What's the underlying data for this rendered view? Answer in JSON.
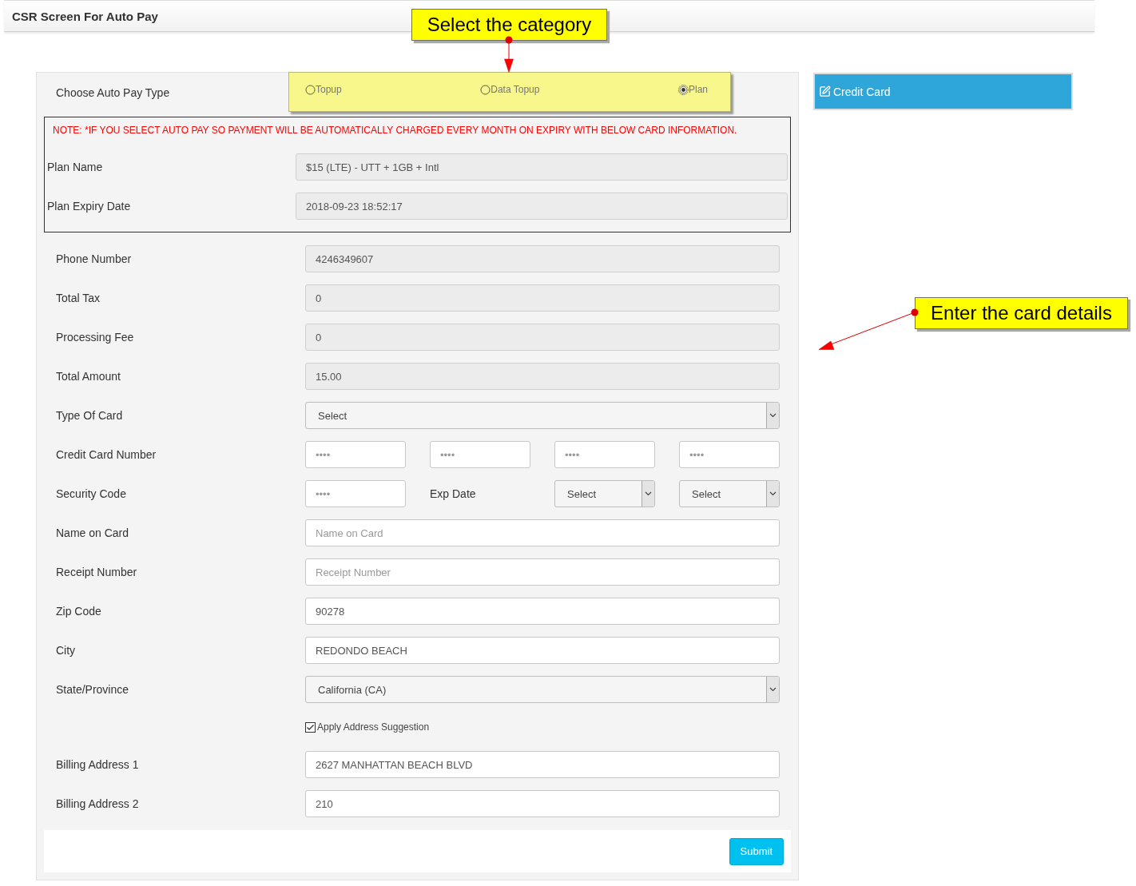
{
  "header": {
    "title": "CSR Screen For Auto Pay"
  },
  "auto_pay_type": {
    "label": "Choose Auto Pay Type",
    "options": [
      {
        "label": "Topup",
        "selected": false
      },
      {
        "label": "Data Topup",
        "selected": false
      },
      {
        "label": "Plan",
        "selected": true
      }
    ]
  },
  "note_box": {
    "note": "NOTE: *IF YOU SELECT AUTO PAY SO PAYMENT WILL BE AUTOMATICALLY CHARGED EVERY MONTH ON EXPIRY WITH BELOW CARD INFORMATION.",
    "fields": [
      {
        "label": "Plan Name",
        "value": "$15 (LTE) - UTT + 1GB + Intl"
      },
      {
        "label": "Plan Expiry Date",
        "value": "2018-09-23 18:52:17"
      }
    ]
  },
  "form_rows": [
    {
      "kind": "readonly",
      "label": "Phone Number",
      "value": "4246349607"
    },
    {
      "kind": "readonly",
      "label": "Total Tax",
      "value": "0"
    },
    {
      "kind": "readonly",
      "label": "Processing Fee",
      "value": "0"
    },
    {
      "kind": "readonly",
      "label": "Total Amount",
      "value": "15.00"
    },
    {
      "kind": "select",
      "label": "Type Of Card",
      "value": "Select"
    },
    {
      "kind": "multi",
      "label": "Credit Card Number",
      "cells": [
        {
          "kind": "input",
          "placeholder": "••••"
        },
        {
          "kind": "input",
          "placeholder": "••••"
        },
        {
          "kind": "input",
          "placeholder": "••••"
        },
        {
          "kind": "input",
          "placeholder": "••••"
        }
      ]
    },
    {
      "kind": "multi",
      "label": "Security Code",
      "cells": [
        {
          "kind": "input",
          "placeholder": "••••"
        },
        {
          "kind": "text",
          "text": "Exp Date"
        },
        {
          "kind": "select",
          "value": "Select"
        },
        {
          "kind": "select",
          "value": "Select"
        }
      ]
    },
    {
      "kind": "input",
      "label": "Name on Card",
      "placeholder": "Name on Card"
    },
    {
      "kind": "input",
      "label": "Receipt Number",
      "placeholder": "Receipt Number"
    },
    {
      "kind": "input",
      "label": "Zip Code",
      "value": "90278"
    },
    {
      "kind": "input",
      "label": "City",
      "value": "REDONDO BEACH"
    },
    {
      "kind": "select",
      "label": "State/Province",
      "value": "California (CA)"
    },
    {
      "kind": "checkbox",
      "text": "Apply Address Suggestion",
      "checked": true
    },
    {
      "kind": "input",
      "label": "Billing Address 1",
      "value": "2627 MANHATTAN BEACH BLVD"
    },
    {
      "kind": "input",
      "label": "Billing Address 2",
      "value": "210"
    }
  ],
  "submit_button": "Submit",
  "side_tab": {
    "label": "Credit Card"
  },
  "callouts": [
    {
      "text": "Select the category"
    },
    {
      "text": "Enter the card details"
    }
  ]
}
